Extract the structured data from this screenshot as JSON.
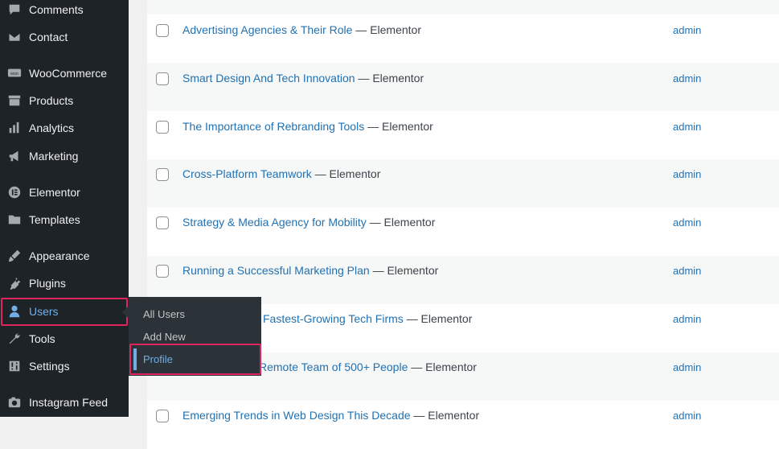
{
  "sidebar": {
    "items": [
      {
        "label": "Comments",
        "icon": "comment-icon"
      },
      {
        "label": "Contact",
        "icon": "mail-icon"
      },
      {
        "label": "WooCommerce",
        "icon": "woocommerce-icon"
      },
      {
        "label": "Products",
        "icon": "archive-icon"
      },
      {
        "label": "Analytics",
        "icon": "bar-chart-icon"
      },
      {
        "label": "Marketing",
        "icon": "megaphone-icon"
      },
      {
        "label": "Elementor",
        "icon": "elementor-icon"
      },
      {
        "label": "Templates",
        "icon": "folder-icon"
      },
      {
        "label": "Appearance",
        "icon": "paintbrush-icon"
      },
      {
        "label": "Plugins",
        "icon": "plug-icon"
      },
      {
        "label": "Users",
        "icon": "user-icon"
      },
      {
        "label": "Tools",
        "icon": "wrench-icon"
      },
      {
        "label": "Settings",
        "icon": "sliders-icon"
      },
      {
        "label": "Instagram Feed",
        "icon": "camera-icon"
      }
    ]
  },
  "flyout": {
    "items": [
      {
        "label": "All Users"
      },
      {
        "label": "Add New"
      },
      {
        "label": "Profile"
      }
    ]
  },
  "posts": {
    "rows": [
      {
        "title": "Advertising Agencies & Their Role",
        "suffix": " — Elementor",
        "author": "admin"
      },
      {
        "title": "Smart Design And Tech Innovation",
        "suffix": " — Elementor",
        "author": "admin"
      },
      {
        "title": "The Importance of Rebranding Tools",
        "suffix": " — Elementor",
        "author": "admin"
      },
      {
        "title": "Cross-Platform Teamwork",
        "suffix": " — Elementor",
        "author": "admin"
      },
      {
        "title": "Strategy & Media Agency for Mobility",
        "suffix": " — Elementor",
        "author": "admin"
      },
      {
        "title": "Running a Successful Marketing Plan",
        "suffix": " — Elementor",
        "author": "admin"
      },
      {
        "title": "Fastest-Growing Tech Firms",
        "suffix": " — Elementor",
        "author": "admin"
      },
      {
        "title": "Remote Team of 500+ People",
        "suffix": " — Elementor",
        "author": "admin"
      },
      {
        "title": "Emerging Trends in Web Design This Decade",
        "suffix": " — Elementor",
        "author": "admin"
      }
    ]
  },
  "colors": {
    "sidebar_bg": "#1d2327",
    "link": "#2271b1",
    "highlight": "#e0245e",
    "current": "#72aee6"
  }
}
